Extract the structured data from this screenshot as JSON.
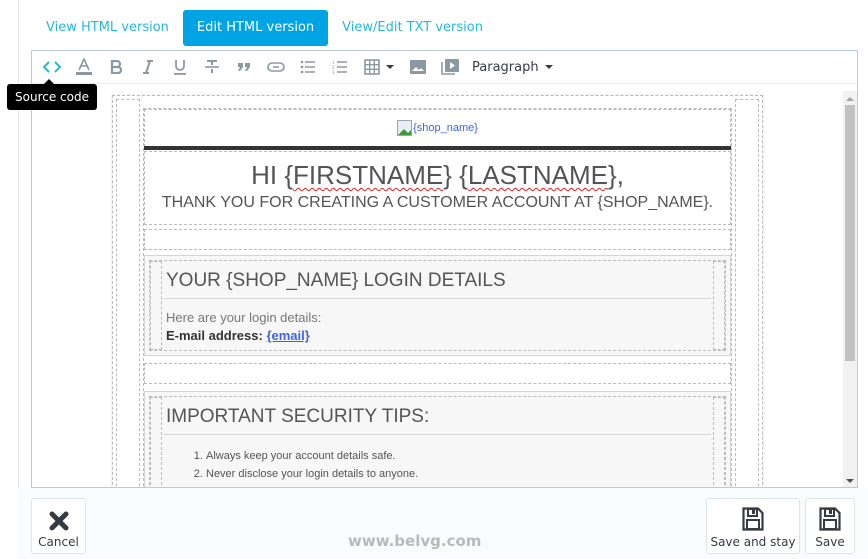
{
  "tabs": [
    {
      "label": "View HTML version",
      "active": false
    },
    {
      "label": "Edit HTML version",
      "active": true
    },
    {
      "label": "View/Edit TXT version",
      "active": false
    }
  ],
  "toolbar": {
    "buttons": [
      {
        "name": "source-code",
        "icon": "code-icon"
      },
      {
        "name": "text-color",
        "icon": "text-color-icon"
      },
      {
        "name": "bold",
        "icon": "bold-icon"
      },
      {
        "name": "italic",
        "icon": "italic-icon"
      },
      {
        "name": "underline",
        "icon": "underline-icon"
      },
      {
        "name": "strikethrough",
        "icon": "strikethrough-icon"
      },
      {
        "name": "blockquote",
        "icon": "quote-icon"
      },
      {
        "name": "link",
        "icon": "link-icon"
      },
      {
        "name": "bullet-list",
        "icon": "bullet-list-icon"
      },
      {
        "name": "numbered-list",
        "icon": "numbered-list-icon"
      },
      {
        "name": "table",
        "icon": "table-icon"
      },
      {
        "name": "image",
        "icon": "image-icon"
      },
      {
        "name": "media",
        "icon": "media-icon"
      }
    ],
    "format_select": "Paragraph",
    "active_color": "#25b9d7"
  },
  "tooltip": "Source code",
  "email": {
    "logo_alt": "{shop_name}",
    "greeting_prefix": "HI",
    "greeting_first": "{FIRSTNAME}",
    "greeting_last": "{LASTNAME}",
    "greeting_suffix": ",",
    "subtitle": "THANK YOU FOR CREATING A CUSTOMER ACCOUNT AT {SHOP_NAME}.",
    "login_panel": {
      "title": "YOUR {SHOP_NAME} LOGIN DETAILS",
      "intro": "Here are your login details:",
      "email_label": "E-mail address:",
      "email_value": "{email}"
    },
    "tips_panel": {
      "title": "IMPORTANT SECURITY TIPS:",
      "items": [
        "Always keep your account details safe.",
        "Never disclose your login details to anyone."
      ]
    }
  },
  "footer": {
    "cancel_label": "Cancel",
    "save_stay_label": "Save and stay",
    "save_label": "Save",
    "watermark": "www.belvg.com"
  }
}
